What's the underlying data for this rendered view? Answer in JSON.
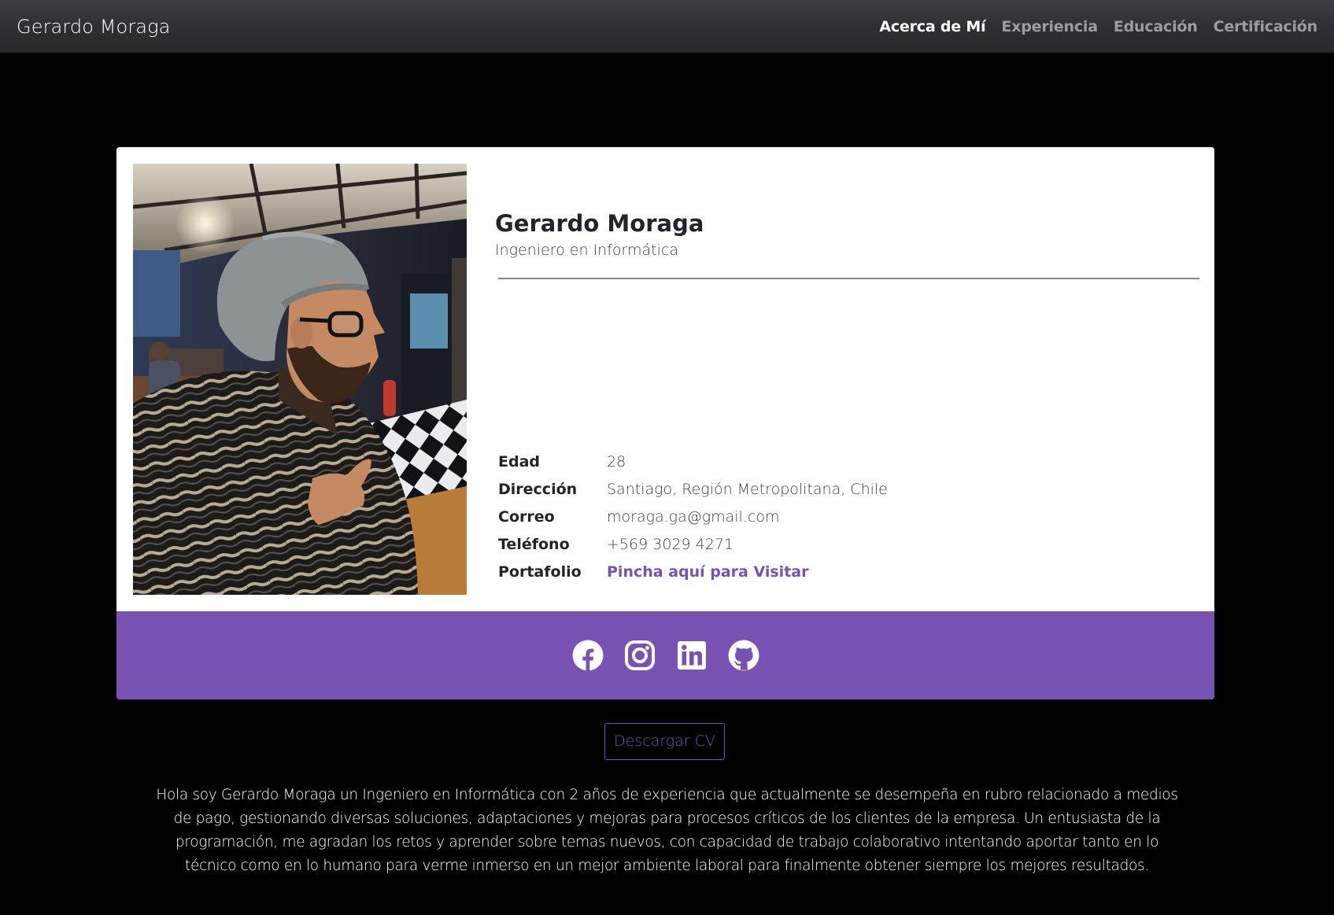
{
  "navbar": {
    "brand": "Gerardo Moraga",
    "links": [
      {
        "label": "Acerca de Mí",
        "active": true
      },
      {
        "label": "Experiencia",
        "active": false
      },
      {
        "label": "Educación",
        "active": false
      },
      {
        "label": "Certificación",
        "active": false
      }
    ]
  },
  "profile": {
    "name": "Gerardo Moraga",
    "title": "Ingeniero en Informática",
    "details": [
      {
        "label": "Edad",
        "value": "28"
      },
      {
        "label": "Dirección",
        "value": "Santiago, Región Metropolitana, Chile"
      },
      {
        "label": "Correo",
        "value": "moraga.ga@gmail.com"
      },
      {
        "label": "Teléfono",
        "value": "+569 3029 4271"
      }
    ],
    "portfolio": {
      "label": "Portafolio",
      "link_text": "Pincha aquí para Visitar"
    },
    "social_icons": [
      "facebook-icon",
      "instagram-icon",
      "linkedin-icon",
      "github-icon"
    ]
  },
  "cv_button": "Descargar CV",
  "bio": "Hola soy Gerardo Moraga un Ingeniero en Informática con 2 años de experiencia que actualmente se desempeña en rubro relacionado a medios de pago, gestionando diversas soluciones, adaptaciones y mejoras para procesos críticos de los clientes de la empresa. Un entusiasta de la programación, me agradan los retos y aprender sobre temas nuevos, con capacidad de trabajo colaborativo intentando aportar tanto en lo técnico como en lo humano para verme inmerso en un mejor ambiente laboral para finalmente obtener siempre los mejores resultados.",
  "colors": {
    "accent": "#7752b3",
    "page_background": "#000000",
    "card_background": "#ffffff",
    "navbar_background": "#2c3034"
  }
}
